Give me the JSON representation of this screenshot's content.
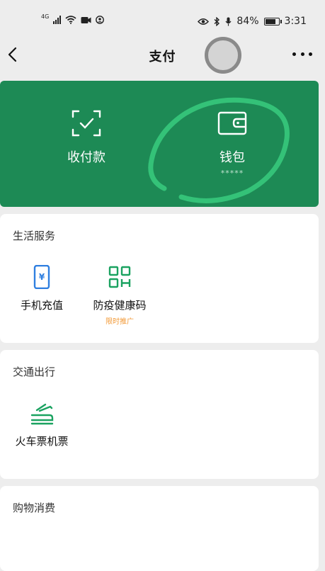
{
  "statusbar": {
    "network": "4G",
    "battery": "84%",
    "battery_level": 0.84,
    "time": "3:31"
  },
  "navbar": {
    "title": "支付"
  },
  "paycard": {
    "items": [
      {
        "label": "收付款",
        "icon": "scan-frame-icon"
      },
      {
        "label": "钱包",
        "icon": "wallet-icon",
        "sub": "*****"
      }
    ]
  },
  "sections": [
    {
      "title": "生活服务",
      "items": [
        {
          "label": "手机充值",
          "icon": "phone-yuan-icon"
        },
        {
          "label": "防疫健康码",
          "icon": "qr-code-icon",
          "tag": "限时推广"
        }
      ]
    },
    {
      "title": "交通出行",
      "items": [
        {
          "label": "火车票机票",
          "icon": "train-plane-icon"
        }
      ]
    },
    {
      "title": "购物消费",
      "items": []
    }
  ],
  "colors": {
    "card_green": "#1d8a55",
    "icon_green": "#1aa260",
    "icon_blue": "#2f7fe0",
    "tag_orange": "#f29a38",
    "swirl_green": "#36c57a"
  }
}
